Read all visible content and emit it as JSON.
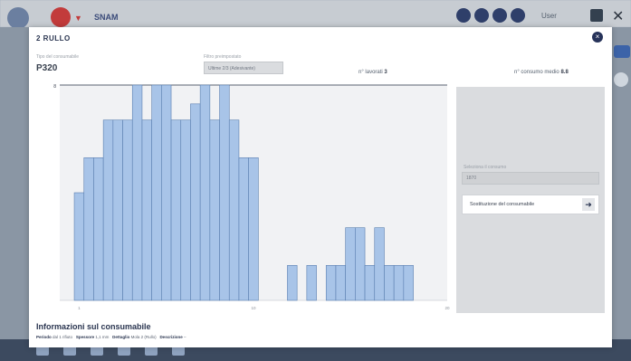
{
  "modal": {
    "title": "2 RULLO",
    "close_symbol": "×",
    "type_label": "Tipo del consumabile",
    "type_value": "P320",
    "preset_label": "Filtro preimpostato",
    "preset_value": "Ultime 2/3 (Adesivante)",
    "stats": {
      "lavori_label": "n° lavorati",
      "lavori_value": "3",
      "consumo_label": "n° consumo medio",
      "consumo_value": "8.8"
    }
  },
  "chart_data": {
    "type": "bar",
    "x_min": 0,
    "x_max": 20,
    "bar_width": 0.5,
    "ylim": [
      0,
      8
    ],
    "xtick_labels": [
      "1",
      "10",
      "20"
    ],
    "ytick_label": "8",
    "bar_color": "#a8c4e8",
    "bar_edge": "#5a7fb0",
    "bars": [
      {
        "x": 1.0,
        "y": 4.0
      },
      {
        "x": 1.5,
        "y": 5.3
      },
      {
        "x": 2.0,
        "y": 5.3
      },
      {
        "x": 2.5,
        "y": 6.7
      },
      {
        "x": 3.0,
        "y": 6.7
      },
      {
        "x": 3.5,
        "y": 6.7
      },
      {
        "x": 4.0,
        "y": 8.0
      },
      {
        "x": 4.5,
        "y": 6.7
      },
      {
        "x": 5.0,
        "y": 8.0
      },
      {
        "x": 5.5,
        "y": 8.0
      },
      {
        "x": 6.0,
        "y": 6.7
      },
      {
        "x": 6.5,
        "y": 6.7
      },
      {
        "x": 7.0,
        "y": 7.3
      },
      {
        "x": 7.5,
        "y": 8.0
      },
      {
        "x": 8.0,
        "y": 6.7
      },
      {
        "x": 8.5,
        "y": 8.0
      },
      {
        "x": 9.0,
        "y": 6.7
      },
      {
        "x": 9.5,
        "y": 5.3
      },
      {
        "x": 10.0,
        "y": 5.3
      },
      {
        "x": 12.0,
        "y": 1.3
      },
      {
        "x": 13.0,
        "y": 1.3
      },
      {
        "x": 14.0,
        "y": 1.3
      },
      {
        "x": 14.5,
        "y": 1.3
      },
      {
        "x": 15.0,
        "y": 2.7
      },
      {
        "x": 15.5,
        "y": 2.7
      },
      {
        "x": 16.0,
        "y": 1.3
      },
      {
        "x": 16.5,
        "y": 2.7
      },
      {
        "x": 17.0,
        "y": 1.3
      },
      {
        "x": 17.5,
        "y": 1.3
      },
      {
        "x": 18.0,
        "y": 1.3
      }
    ]
  },
  "side_panel": {
    "field_label": "Seleziona il consumo",
    "field_value": "1870",
    "button_label": "Sostituzione del consumabile",
    "button_icon": "arrow-right-icon"
  },
  "info": {
    "heading": "Informazioni sul consumabile",
    "details": [
      {
        "label": "Periodo",
        "value": "dal 1 rifiuto"
      },
      {
        "label": "Spessore",
        "value": "1,1 mm"
      },
      {
        "label": "Dettaglio",
        "value": "Mola 2 (Rullo)"
      },
      {
        "label": "Descrizione",
        "value": "–"
      }
    ]
  },
  "background": {
    "home_label": "SNAM",
    "user_label": "User"
  }
}
